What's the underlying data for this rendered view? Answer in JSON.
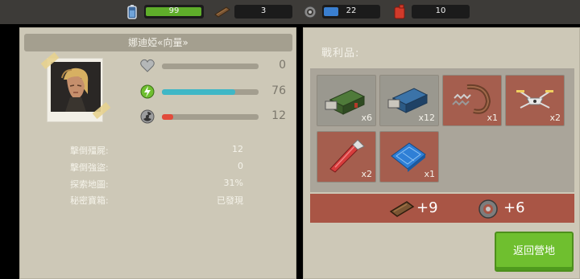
{
  "resources": [
    {
      "icon": "battery-icon",
      "value": "99",
      "fill": 0.99,
      "color": "#5fae2a"
    },
    {
      "icon": "wood-plank-icon",
      "value": "3",
      "fill": 0,
      "color": "#6b4a2a"
    },
    {
      "icon": "gear-icon",
      "value": "22",
      "fill": 0.22,
      "color": "#3a7fd0"
    },
    {
      "icon": "fuel-can-icon",
      "value": "10",
      "fill": 0,
      "color": "#d23a2a"
    }
  ],
  "character": {
    "name": "娜迪婭«向量»",
    "stats": [
      {
        "icon": "heart-icon",
        "value": "0",
        "fill": 0,
        "color": "#b0b0b0"
      },
      {
        "icon": "energy-icon",
        "value": "76",
        "fill": 0.76,
        "color": "#3fb7c6"
      },
      {
        "icon": "radiation-icon",
        "value": "12",
        "fill": 0.12,
        "color": "#e24b3b"
      }
    ],
    "info": [
      {
        "key": "擊倒殭屍:",
        "value": "12"
      },
      {
        "key": "擊倒強盜:",
        "value": "0"
      },
      {
        "key": "探索地圖:",
        "value": "31%"
      },
      {
        "key": "秘密寶箱:",
        "value": "已發現"
      }
    ]
  },
  "loot": {
    "title": "戰利品:",
    "items": [
      {
        "icon": "green-toolbox-icon",
        "qty": "x6",
        "style": "grey"
      },
      {
        "icon": "blue-toolbox-icon",
        "qty": "x12",
        "style": "grey"
      },
      {
        "icon": "spring-parts-icon",
        "qty": "x1",
        "style": "red"
      },
      {
        "icon": "drone-icon",
        "qty": "x2",
        "style": "red"
      },
      {
        "icon": "flashlight-icon",
        "qty": "x2",
        "style": "red"
      },
      {
        "icon": "blueprint-icon",
        "qty": "x1",
        "style": "red"
      }
    ],
    "gains": [
      {
        "icon": "wood-plank-icon",
        "value": "+9"
      },
      {
        "icon": "gear-icon",
        "value": "+6"
      }
    ]
  },
  "back_button": "返回營地"
}
